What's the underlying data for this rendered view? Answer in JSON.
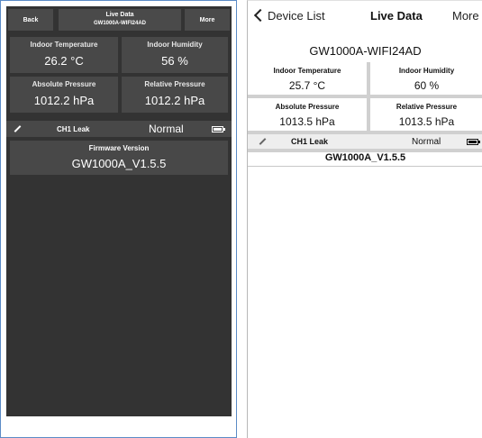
{
  "left": {
    "back_label": "Back",
    "title": "Live Data",
    "station": "GW1000A-WIFI24AD",
    "more_label": "More",
    "indoor_temp_label": "Indoor Temperature",
    "indoor_temp_value": "26.2 °C",
    "indoor_hum_label": "Indoor Humidity",
    "indoor_hum_value": "56 %",
    "abs_pressure_label": "Absolute Pressure",
    "abs_pressure_value": "1012.2 hPa",
    "rel_pressure_label": "Relative Pressure",
    "rel_pressure_value": "1012.2 hPa",
    "ch1_label": "CH1 Leak",
    "ch1_status": "Normal",
    "firmware_label": "Firmware Version",
    "firmware_value": "GW1000A_V1.5.5"
  },
  "right": {
    "back_label": "Device List",
    "title": "Live Data",
    "more_label": "More",
    "station": "GW1000A-WIFI24AD",
    "indoor_temp_label": "Indoor Temperature",
    "indoor_temp_value": "25.7 °C",
    "indoor_hum_label": "Indoor Humidity",
    "indoor_hum_value": "60 %",
    "abs_pressure_label": "Absolute Pressure",
    "abs_pressure_value": "1013.5 hPa",
    "rel_pressure_label": "Relative Pressure",
    "rel_pressure_value": "1013.5 hPa",
    "ch1_label": "CH1 Leak",
    "ch1_status": "Normal",
    "firmware_value": "GW1000A_V1.5.5"
  },
  "icons": {
    "edit": "pencil-icon",
    "battery": "battery-icon",
    "back": "chevron-left-icon"
  },
  "colors": {
    "dark_background": "#333333",
    "dark_cell": "#484848",
    "light_separator": "#d0d0d0",
    "frame_blue": "#5b8bc6"
  }
}
